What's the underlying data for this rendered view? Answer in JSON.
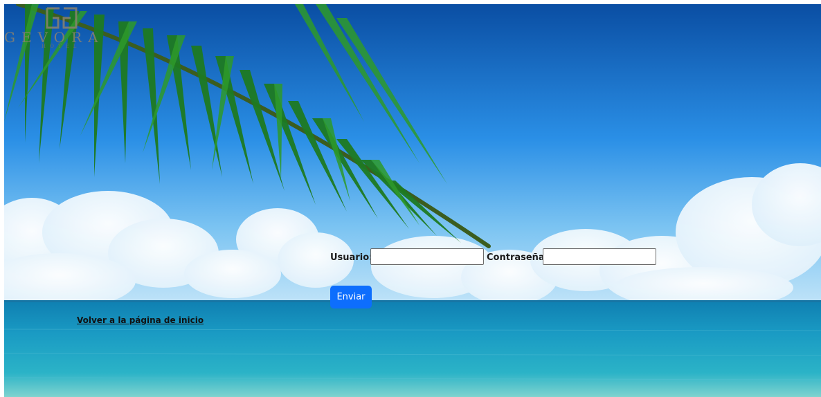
{
  "brand": {
    "logo_text": "GEVORA",
    "logo_subtext": "HOTEL",
    "logo_color": "#8a8270"
  },
  "login": {
    "user_label": "Usuario:",
    "user_value": "",
    "password_label": "Contraseña:",
    "password_value": "",
    "submit_label": "Enviar"
  },
  "links": {
    "home": "Volver a la página de inicio"
  },
  "colors": {
    "accent": "#0d6efd",
    "sky_top": "#0a4ea3",
    "sea": "#1a8fb8"
  },
  "icons": {
    "logo": "gevora-logo-mark"
  }
}
